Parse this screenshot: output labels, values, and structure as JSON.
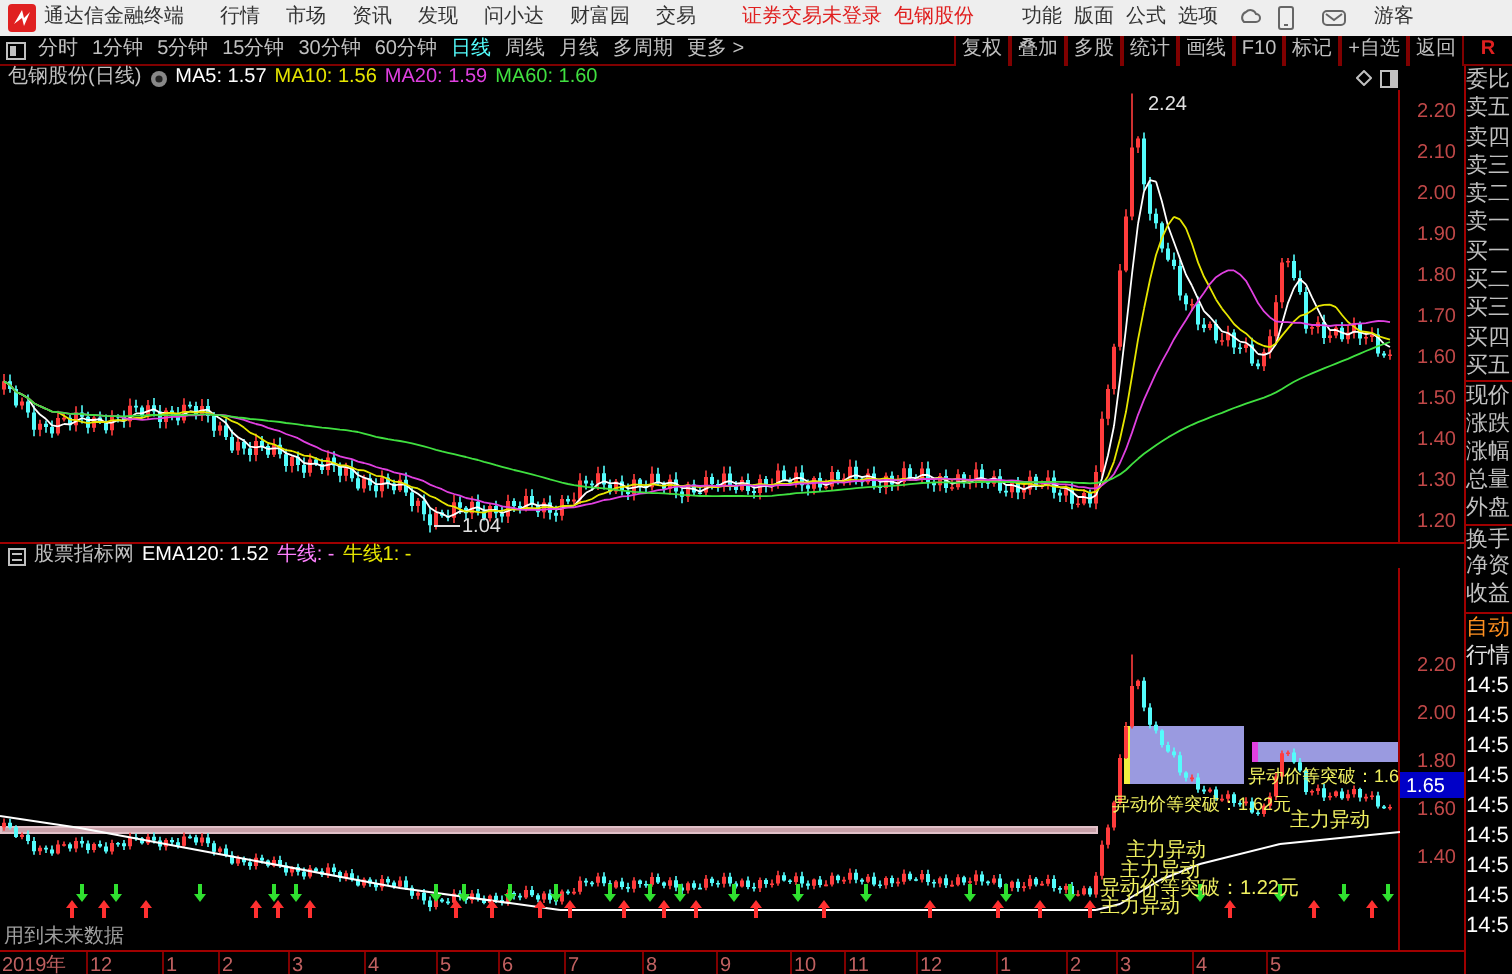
{
  "menu_bar": {
    "app_title": "通达信金融终端",
    "menus": [
      "行情",
      "市场",
      "资讯",
      "发现",
      "问小达",
      "财富园",
      "交易"
    ],
    "notice": "证券交易未登录",
    "stock": "包钢股份",
    "tools": [
      "功能",
      "版面",
      "公式",
      "选项"
    ],
    "user": "游客"
  },
  "period_bar": {
    "tabs": [
      {
        "label": "分时",
        "selected": false
      },
      {
        "label": "1分钟",
        "selected": false
      },
      {
        "label": "5分钟",
        "selected": false
      },
      {
        "label": "15分钟",
        "selected": false
      },
      {
        "label": "30分钟",
        "selected": false
      },
      {
        "label": "60分钟",
        "selected": false
      },
      {
        "label": "日线",
        "selected": true
      },
      {
        "label": "周线",
        "selected": false
      },
      {
        "label": "月线",
        "selected": false
      },
      {
        "label": "多周期",
        "selected": false
      },
      {
        "label": "更多 >",
        "selected": false
      }
    ],
    "buttons": [
      "复权",
      "叠加",
      "多股",
      "统计",
      "画线",
      "F10",
      "标记",
      "+自选",
      "返回"
    ],
    "corner": "R"
  },
  "price_pane": {
    "title": "包钢股份(日线)",
    "indicators": [
      {
        "label": "MA5: 1.57",
        "color": "#ffffff"
      },
      {
        "label": "MA10: 1.56",
        "color": "#e6e600"
      },
      {
        "label": "MA20: 1.59",
        "color": "#e040e0"
      },
      {
        "label": "MA60: 1.60",
        "color": "#40e040"
      }
    ],
    "yticks": [
      "2.20",
      "2.10",
      "2.00",
      "1.90",
      "1.80",
      "1.70",
      "1.60",
      "1.50",
      "1.40",
      "1.30",
      "1.20"
    ],
    "high_label": "2.24",
    "low_label": "1.04"
  },
  "indicator_pane": {
    "title": "股票指标网",
    "indicators": [
      {
        "label": "EMA120: 1.52",
        "color": "#ffffff"
      },
      {
        "label": "牛线: -",
        "color": "#ff80ff"
      },
      {
        "label": "牛线1: -",
        "color": "#e6e600"
      }
    ],
    "yticks": [
      "2.20",
      "2.00",
      "1.80",
      "1.60",
      "1.40"
    ],
    "current_price": "1.65",
    "signals": [
      "异动价等突破：1.62元",
      "异动价等突破：1.6",
      "主力异动",
      "主力异动",
      "主力异动",
      "异动价等突破：1.22元",
      "主力异动"
    ],
    "note": "用到未来数据"
  },
  "time_axis": [
    "2019年",
    "12",
    "1",
    "2",
    "3",
    "4",
    "5",
    "6",
    "7",
    "8",
    "9",
    "10",
    "11",
    "12",
    "1",
    "2",
    "3",
    "4",
    "5"
  ],
  "quote_panel": {
    "labels": [
      "委比",
      "卖五",
      "卖四",
      "卖三",
      "卖二",
      "卖一",
      "买一",
      "买二",
      "买三",
      "买四",
      "买五",
      "现价",
      "涨跌",
      "涨幅",
      "总量",
      "外盘",
      "换手",
      "净资",
      "收益"
    ],
    "auto": "自动",
    "market": "行情",
    "times": [
      "14:5",
      "14:5",
      "14:5",
      "14:5",
      "14:5",
      "14:5",
      "14:5",
      "14:5",
      "14:5"
    ]
  }
}
